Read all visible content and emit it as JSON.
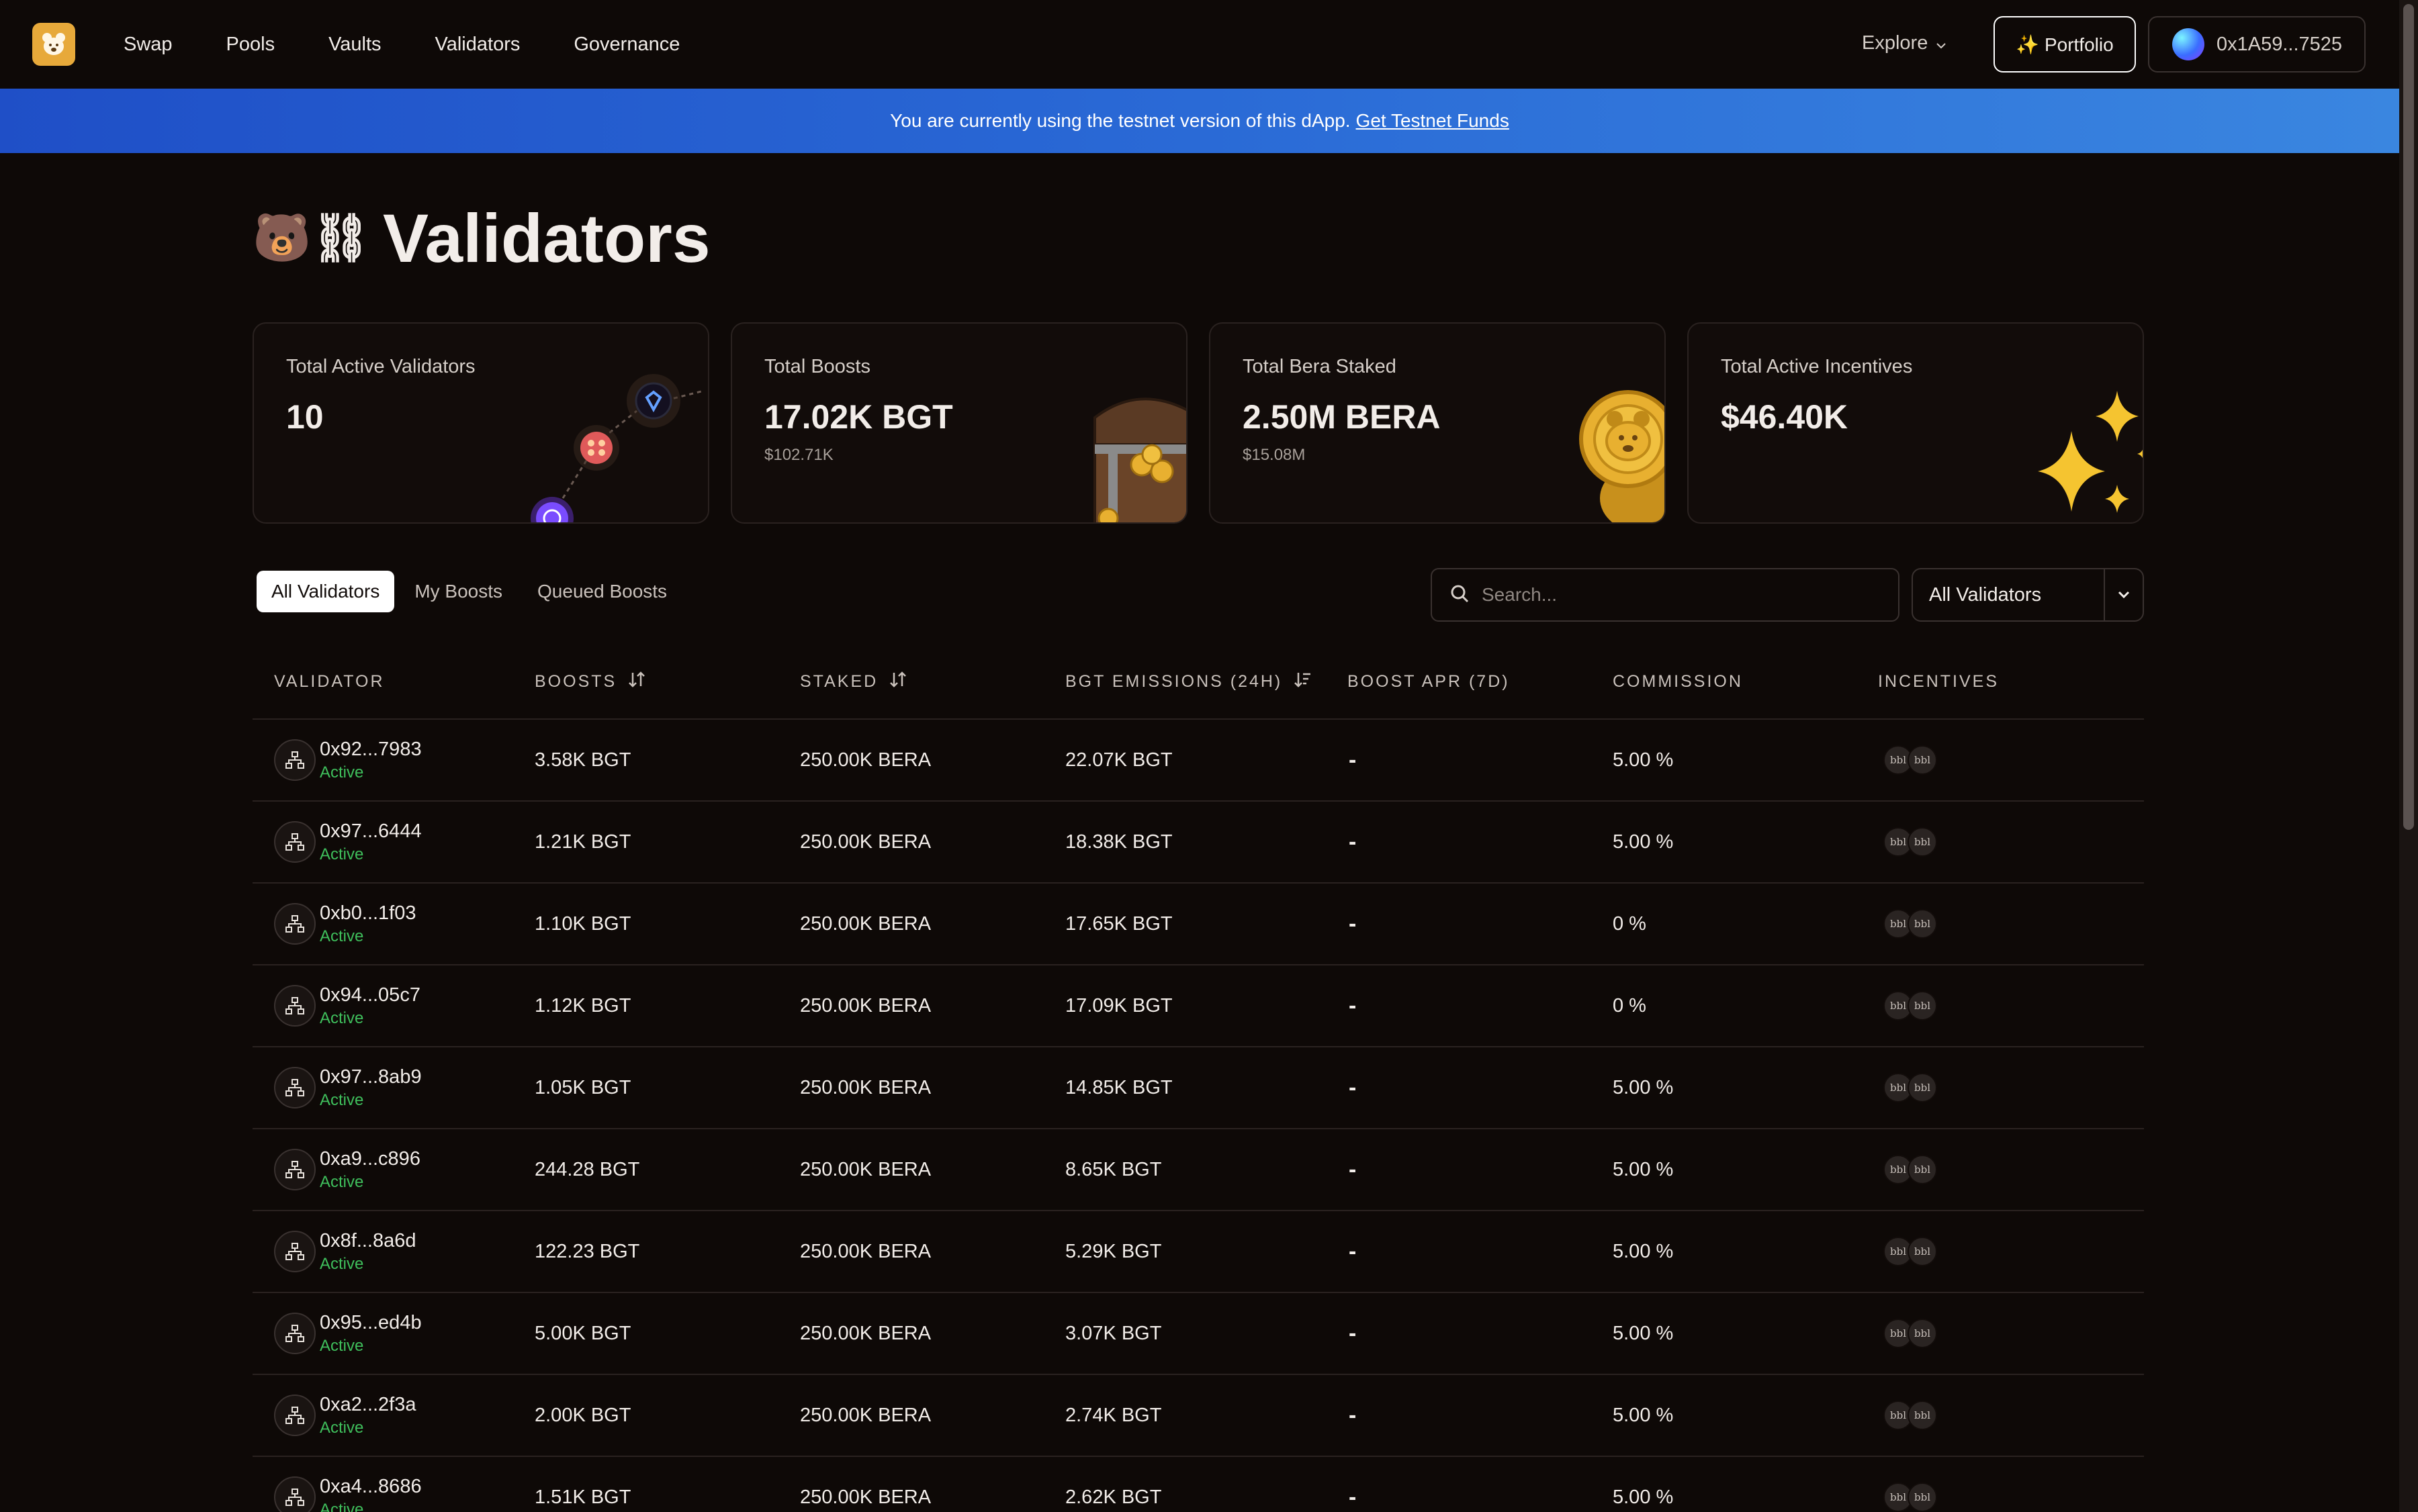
{
  "nav": {
    "items": [
      "Swap",
      "Pools",
      "Vaults",
      "Validators",
      "Governance"
    ],
    "explore_label": "Explore",
    "portfolio_label": "✨ Portfolio",
    "wallet_address": "0x1A59...7525"
  },
  "banner": {
    "text": "You are currently using the testnet version of this dApp.",
    "link_label": "Get Testnet Funds"
  },
  "page": {
    "title_emoji": "🐻⛓",
    "title": "Validators"
  },
  "stats": [
    {
      "label": "Total Active Validators",
      "value": "10",
      "sub": ""
    },
    {
      "label": "Total Boosts",
      "value": "17.02K BGT",
      "sub": "$102.71K"
    },
    {
      "label": "Total Bera Staked",
      "value": "2.50M BERA",
      "sub": "$15.08M"
    },
    {
      "label": "Total Active Incentives",
      "value": "$46.40K",
      "sub": ""
    }
  ],
  "tabs": [
    "All Validators",
    "My Boosts",
    "Queued Boosts"
  ],
  "search": {
    "placeholder": "Search..."
  },
  "filter": {
    "selected": "All Validators"
  },
  "table": {
    "columns": [
      "Validator",
      "Boosts",
      "Staked",
      "BGT Emissions (24H)",
      "Boost APR (7D)",
      "Commission",
      "Incentives"
    ],
    "rows": [
      {
        "address": "0x92...7983",
        "status": "Active",
        "boosts": "3.58K BGT",
        "staked": "250.00K BERA",
        "emissions": "22.07K BGT",
        "apr": "-",
        "commission": "5.00 %"
      },
      {
        "address": "0x97...6444",
        "status": "Active",
        "boosts": "1.21K BGT",
        "staked": "250.00K BERA",
        "emissions": "18.38K BGT",
        "apr": "-",
        "commission": "5.00 %"
      },
      {
        "address": "0xb0...1f03",
        "status": "Active",
        "boosts": "1.10K BGT",
        "staked": "250.00K BERA",
        "emissions": "17.65K BGT",
        "apr": "-",
        "commission": "0 %"
      },
      {
        "address": "0x94...05c7",
        "status": "Active",
        "boosts": "1.12K BGT",
        "staked": "250.00K BERA",
        "emissions": "17.09K BGT",
        "apr": "-",
        "commission": "0 %"
      },
      {
        "address": "0x97...8ab9",
        "status": "Active",
        "boosts": "1.05K BGT",
        "staked": "250.00K BERA",
        "emissions": "14.85K BGT",
        "apr": "-",
        "commission": "5.00 %"
      },
      {
        "address": "0xa9...c896",
        "status": "Active",
        "boosts": "244.28 BGT",
        "staked": "250.00K BERA",
        "emissions": "8.65K BGT",
        "apr": "-",
        "commission": "5.00 %"
      },
      {
        "address": "0x8f...8a6d",
        "status": "Active",
        "boosts": "122.23 BGT",
        "staked": "250.00K BERA",
        "emissions": "5.29K BGT",
        "apr": "-",
        "commission": "5.00 %"
      },
      {
        "address": "0x95...ed4b",
        "status": "Active",
        "boosts": "5.00K BGT",
        "staked": "250.00K BERA",
        "emissions": "3.07K BGT",
        "apr": "-",
        "commission": "5.00 %"
      },
      {
        "address": "0xa2...2f3a",
        "status": "Active",
        "boosts": "2.00K BGT",
        "staked": "250.00K BERA",
        "emissions": "2.74K BGT",
        "apr": "-",
        "commission": "5.00 %"
      },
      {
        "address": "0xa4...8686",
        "status": "Active",
        "boosts": "1.51K BGT",
        "staked": "250.00K BERA",
        "emissions": "2.62K BGT",
        "apr": "-",
        "commission": "5.00 %"
      }
    ],
    "incentive_token_label": "bbl"
  }
}
